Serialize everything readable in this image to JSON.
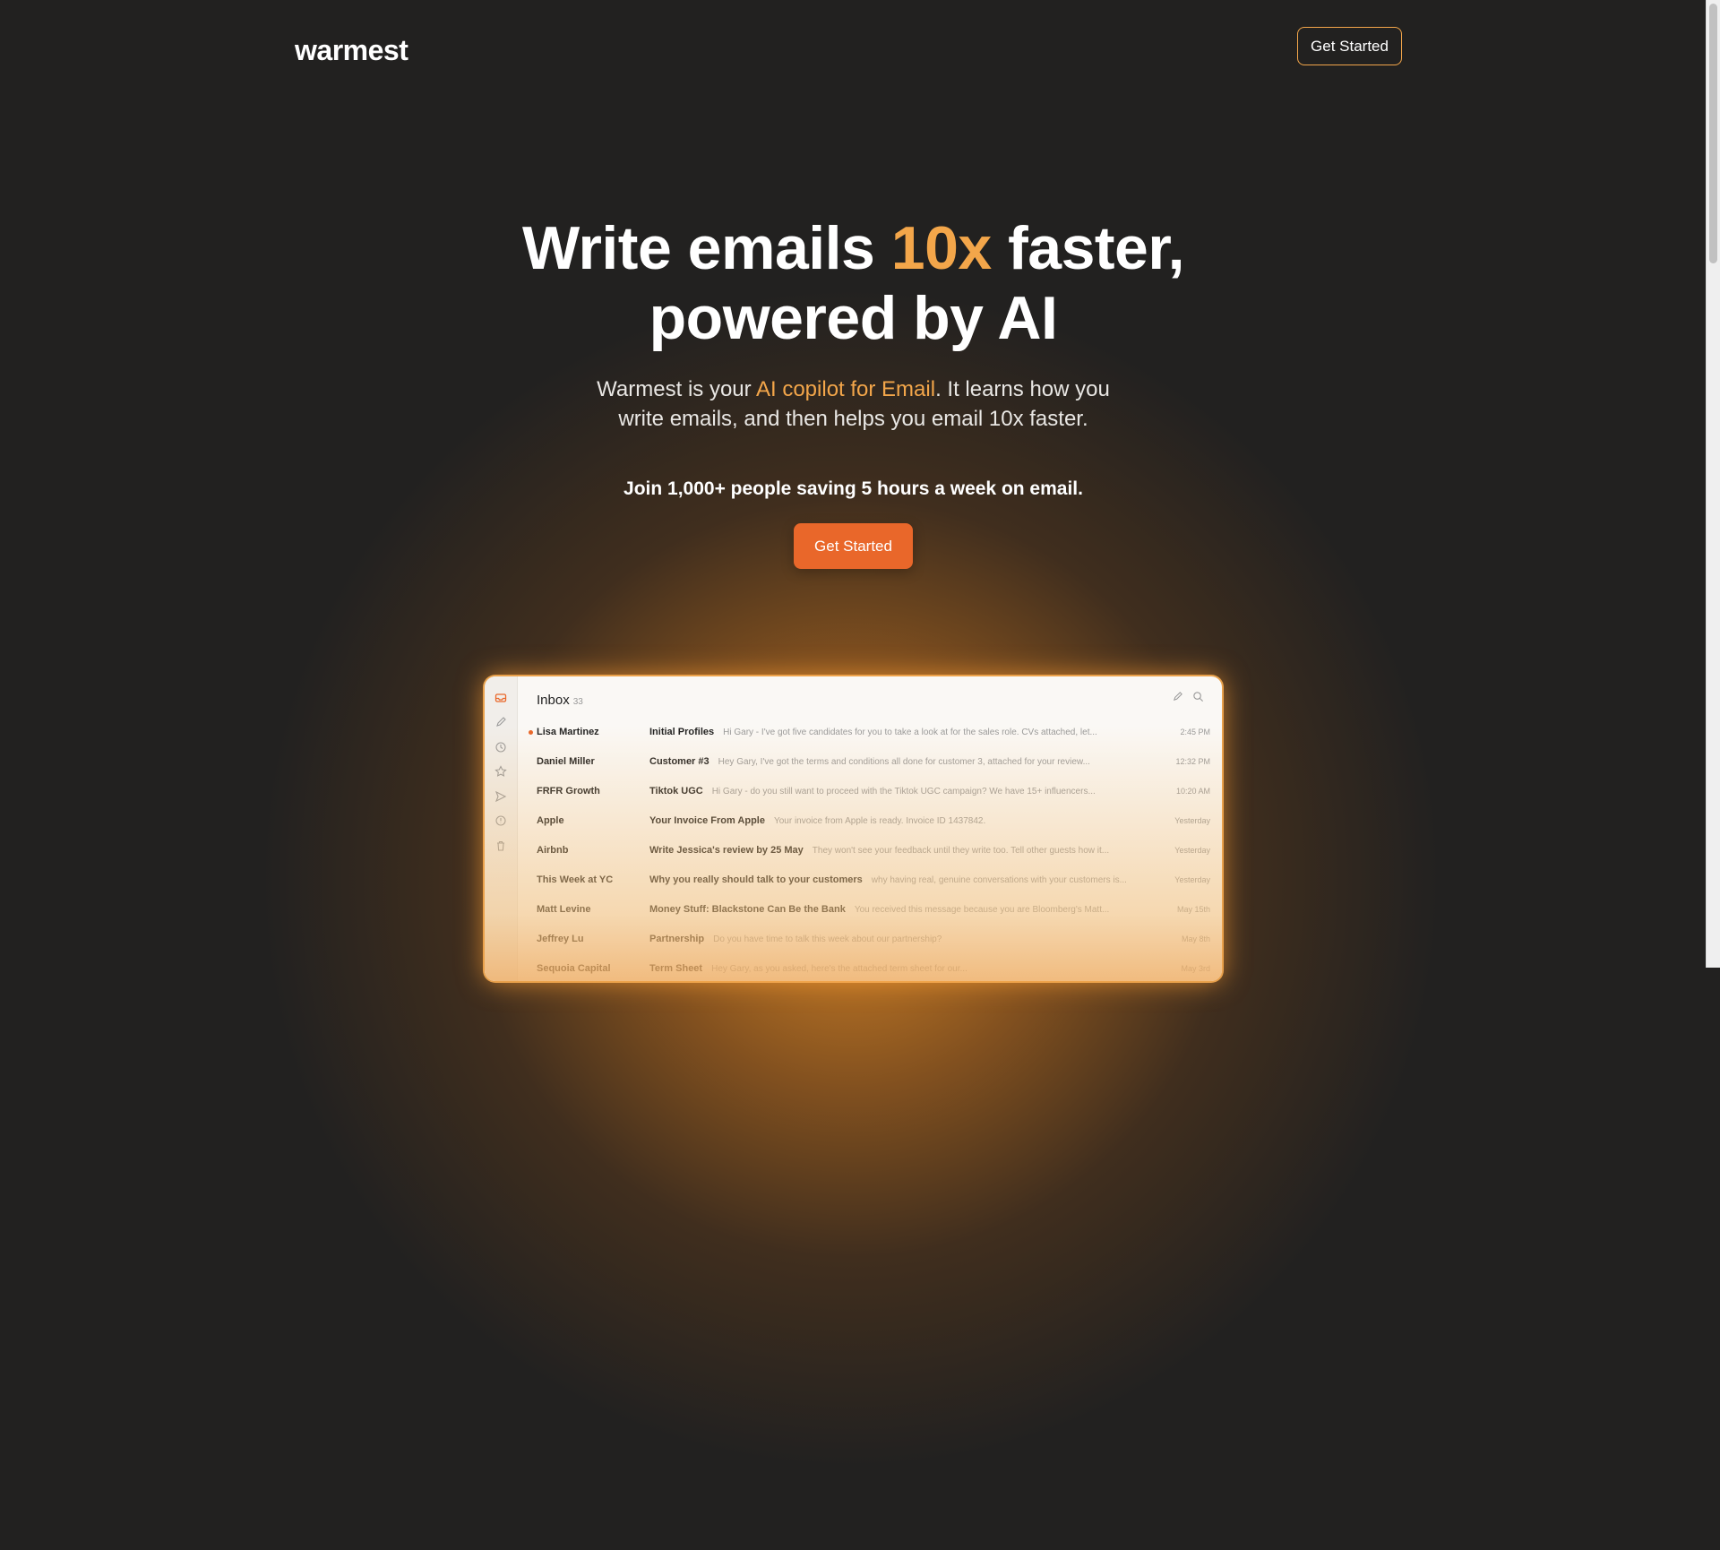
{
  "header": {
    "logo": "warmest",
    "cta_label": "Get Started"
  },
  "hero": {
    "title_part1": "Write emails ",
    "title_accent": "10x",
    "title_part2": " faster,",
    "title_line2": "powered by AI",
    "subtitle_part1": "Warmest is your ",
    "subtitle_accent": "AI copilot for Email",
    "subtitle_part2": ". It learns how you",
    "subtitle_line2": "write emails, and then helps you email 10x faster.",
    "join_text": "Join 1,000+ people saving 5 hours a week on email.",
    "cta_label": "Get Started"
  },
  "app_preview": {
    "inbox_title": "Inbox",
    "inbox_count": "33",
    "rail_icons": [
      "inbox-icon",
      "pencil-icon",
      "clock-icon",
      "star-icon",
      "send-icon",
      "alert-icon",
      "trash-icon"
    ],
    "emails": [
      {
        "sender": "Lisa Martinez",
        "subject": "Initial Profiles",
        "preview": "Hi Gary - I've got five candidates for you to take a look at for the sales role. CVs attached, let...",
        "time": "2:45 PM",
        "unread": true
      },
      {
        "sender": "Daniel Miller",
        "subject": "Customer #3",
        "preview": "Hey Gary, I've got the terms and conditions all done for customer 3, attached for your review...",
        "time": "12:32 PM",
        "unread": false
      },
      {
        "sender": "FRFR Growth",
        "subject": "Tiktok UGC",
        "preview": "Hi Gary - do you still want to proceed with the Tiktok UGC campaign? We have 15+ influencers...",
        "time": "10:20 AM",
        "unread": false
      },
      {
        "sender": "Apple",
        "subject": "Your Invoice From Apple",
        "preview": "Your invoice from Apple is ready. Invoice ID 1437842.",
        "time": "Yesterday",
        "unread": false
      },
      {
        "sender": "Airbnb",
        "subject": "Write Jessica's review by 25 May",
        "preview": "They won't see your feedback until they write too. Tell other guests how it...",
        "time": "Yesterday",
        "unread": false
      },
      {
        "sender": "This Week at YC",
        "subject": "Why you really should talk to your customers",
        "preview": "why having real, genuine conversations with your customers is...",
        "time": "Yesterday",
        "unread": false
      },
      {
        "sender": "Matt Levine",
        "subject": "Money Stuff: Blackstone Can Be the Bank",
        "preview": "You received this message because you are Bloomberg's Matt...",
        "time": "May 15th",
        "unread": false
      },
      {
        "sender": "Jeffrey Lu",
        "subject": "Partnership",
        "preview": "Do you have time to talk this week about our partnership?",
        "time": "May 8th",
        "unread": false
      },
      {
        "sender": "Sequoia Capital",
        "subject": "Term Sheet",
        "preview": "Hey Gary, as you asked, here's the attached term sheet for our...",
        "time": "May 3rd",
        "unread": false
      }
    ]
  },
  "colors": {
    "background": "#222120",
    "accent": "#f3a64a",
    "cta": "#e9672a"
  }
}
